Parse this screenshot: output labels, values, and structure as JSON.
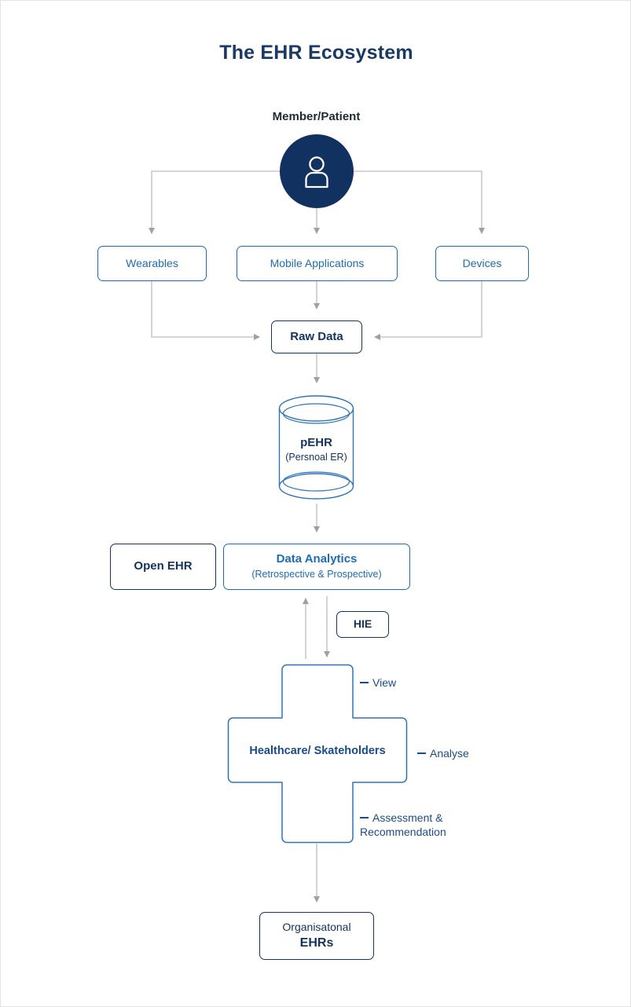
{
  "page": {
    "title": "The EHR Ecosystem",
    "background": "#ffffff",
    "accent_navy": "#14335f",
    "accent_blue": "#1f6cb0",
    "connector_gray": "#a9a9a9"
  },
  "source": {
    "label": "Member/Patient",
    "icon": "person-icon"
  },
  "inputs": [
    {
      "id": "wearables",
      "label": "Wearables"
    },
    {
      "id": "mobile",
      "label": "Mobile Applications"
    },
    {
      "id": "devices",
      "label": "Devices"
    }
  ],
  "raw_data": {
    "label": "Raw Data"
  },
  "store": {
    "title": "pEHR",
    "subtitle": "(Persnoal ER)",
    "shape": "cylinder"
  },
  "standards": {
    "open_ehr": "Open EHR",
    "analytics_title": "Data Analytics",
    "analytics_subtitle": "(Retrospective & Prospective)",
    "hie": "HIE"
  },
  "stakeholders": {
    "label": "Healthcare/ Skateholders",
    "shape": "cross"
  },
  "activities": [
    {
      "id": "view",
      "label": "View"
    },
    {
      "id": "analyse",
      "label": "Analyse"
    },
    {
      "id": "assessment",
      "label": "Assessment & Recommendation"
    }
  ],
  "output": {
    "line1": "Organisatonal",
    "line2": "EHRs"
  }
}
